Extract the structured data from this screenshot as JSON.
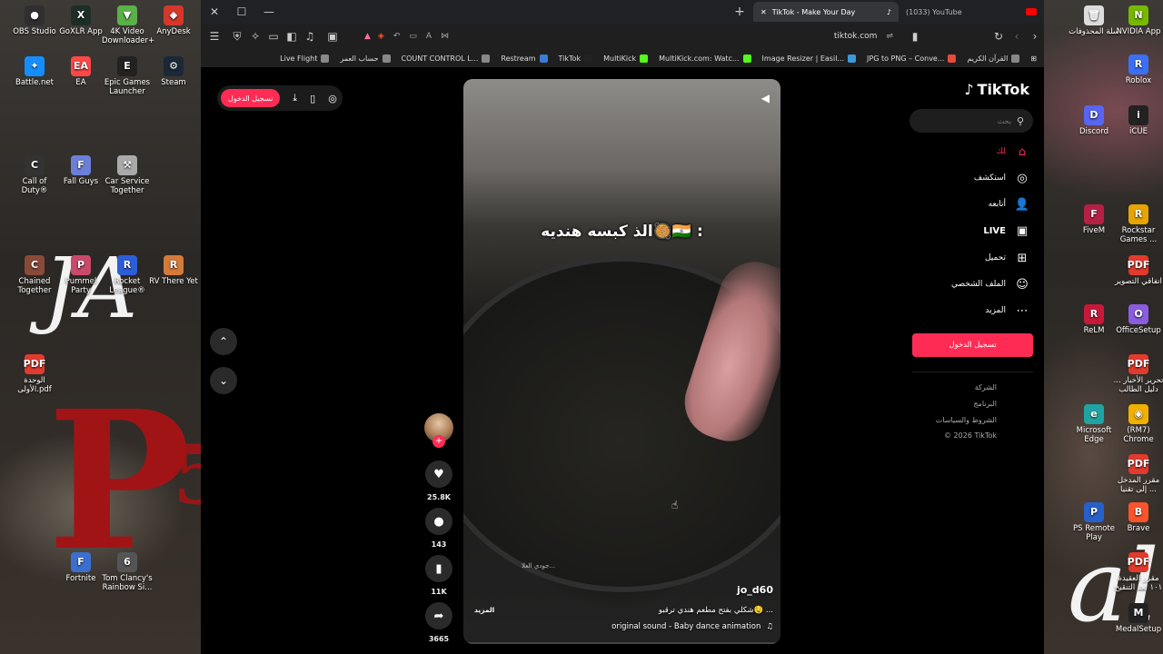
{
  "desktop": {
    "left_icons": [
      {
        "label": "OBS Studio",
        "color": "#302e31",
        "glyph": "●"
      },
      {
        "label": "GoXLR App",
        "color": "#1b2f27",
        "glyph": "X"
      },
      {
        "label": "4K Video Downloader+",
        "color": "#5bb04a",
        "glyph": "▼"
      },
      {
        "label": "AnyDesk",
        "color": "#d5372b",
        "glyph": "◆"
      },
      {
        "label": "Battle.net",
        "color": "#148eff",
        "glyph": "✦"
      },
      {
        "label": "EA",
        "color": "#ff4747",
        "glyph": "EA"
      },
      {
        "label": "Epic Games Launcher",
        "color": "#222",
        "glyph": "E"
      },
      {
        "label": "Steam",
        "color": "#1b2838",
        "glyph": "⚙"
      },
      {
        "label": "Call of Duty®",
        "color": "#333",
        "glyph": "C"
      },
      {
        "label": "Fall Guys",
        "color": "#6c7fd8",
        "glyph": "F"
      },
      {
        "label": "Car Service Together",
        "color": "#aaa",
        "glyph": "⚒"
      },
      {
        "label": "Chained Together",
        "color": "#8a4a3a",
        "glyph": "C"
      },
      {
        "label": "Pummel Party",
        "color": "#c94a6b",
        "glyph": "P"
      },
      {
        "label": "Rocket League®",
        "color": "#2d5ed8",
        "glyph": "R"
      },
      {
        "label": "RV There Yet",
        "color": "#d47a3b",
        "glyph": "R"
      },
      {
        "label": "الوحدة الأولى.pdf",
        "color": "#e23b2e",
        "glyph": "PDF"
      },
      {
        "label": "Fortnite",
        "color": "#3a6fd0",
        "glyph": "F"
      },
      {
        "label": "Tom Clancy's Rainbow Si...",
        "color": "#555",
        "glyph": "6"
      }
    ],
    "right_icons": [
      {
        "label": "سلة المحذوفات",
        "color": "#ddd",
        "glyph": "🗑"
      },
      {
        "label": "NVIDIA App",
        "color": "#76b900",
        "glyph": "N"
      },
      {
        "label": "Roblox",
        "color": "#3b6ff5",
        "glyph": "R"
      },
      {
        "label": "Discord",
        "color": "#5865f2",
        "glyph": "D"
      },
      {
        "label": "iCUE",
        "color": "#222",
        "glyph": "i"
      },
      {
        "label": "FiveM",
        "color": "#b52045",
        "glyph": "F"
      },
      {
        "label": "Rockstar Games ...",
        "color": "#e8a400",
        "glyph": "R"
      },
      {
        "label": "اتفاقي التصوير",
        "color": "#e23b2e",
        "glyph": "PDF"
      },
      {
        "label": "ReLM",
        "color": "#c8183a",
        "glyph": "R"
      },
      {
        "label": "OfficeSetup",
        "color": "#8a5de0",
        "glyph": "O"
      },
      {
        "label": "تحرير الأخبار ... دليل الطالب",
        "color": "#e23b2e",
        "glyph": "PDF"
      },
      {
        "label": "Microsoft Edge",
        "color": "#1fa3a3",
        "glyph": "e"
      },
      {
        "label": "(RM7) Chrome",
        "color": "#f1b000",
        "glyph": "◉"
      },
      {
        "label": "مقرر المدخل ... إلى تقنيا",
        "color": "#e23b2e",
        "glyph": "PDF"
      },
      {
        "label": "PS Remote Play",
        "color": "#2760c9",
        "glyph": "P"
      },
      {
        "label": "Brave",
        "color": "#fb542b",
        "glyph": "B"
      },
      {
        "label": "مقرر العقيدة ١٠١ بعد التنقيح",
        "color": "#e23b2e",
        "glyph": "PDF"
      },
      {
        "label": "MedalSetup",
        "color": "#222",
        "glyph": "M"
      }
    ]
  },
  "browser": {
    "tabs": [
      {
        "title": "TikTok - Make Your Day",
        "active": true
      },
      {
        "title": "(1033) YouTube",
        "active": false
      }
    ],
    "address": "tiktok.com",
    "bookmarks": [
      "Live Flight",
      "حساب العمر",
      "COUNT CONTROL L...",
      "Restream",
      "TikTok",
      "MultiKick",
      "MultiKick.com: Watc...",
      "Image Resizer | Easil...",
      "JPG to PNG – Conve...",
      "القرآن الكريم"
    ],
    "brand_color": "#fe2c55"
  },
  "tiktok": {
    "logo": "TikTok",
    "search_placeholder": "بحث",
    "top_login": "تسجيل الدخول",
    "nav": [
      {
        "label": "لك",
        "icon": "home-icon",
        "glyph": "⌂",
        "active": true
      },
      {
        "label": "استكشف",
        "icon": "compass-icon",
        "glyph": "◎",
        "active": false
      },
      {
        "label": "أتابعه",
        "icon": "user-follow-icon",
        "glyph": "👤",
        "active": false
      },
      {
        "label": "LIVE",
        "icon": "live-tv-icon",
        "glyph": "▣",
        "active": false
      },
      {
        "label": "تحميل",
        "icon": "upload-icon",
        "glyph": "⊞",
        "active": false
      },
      {
        "label": "الملف الشخصي",
        "icon": "profile-icon",
        "glyph": "☺",
        "active": false
      },
      {
        "label": "المزيد",
        "icon": "more-icon",
        "glyph": "⋯",
        "active": false
      }
    ],
    "login_button": "تسجيل الدخول",
    "footer": [
      "الشركة",
      "البرنامج",
      "الشروط والسياسات",
      "© 2026 TikTok"
    ],
    "video": {
      "caption": "الذ كبسه هنديه🥘🇮🇳 :",
      "watermark": "جودي العلا...",
      "author": "jo_d60",
      "description": "شكلي بفتح مطعم هندي ترقبو🤤 ...",
      "more": "المزيد",
      "sound": "original sound - Baby dance animation"
    },
    "actions": {
      "likes": "25.8K",
      "comments": "143",
      "saves": "11K",
      "shares": "3665"
    }
  }
}
